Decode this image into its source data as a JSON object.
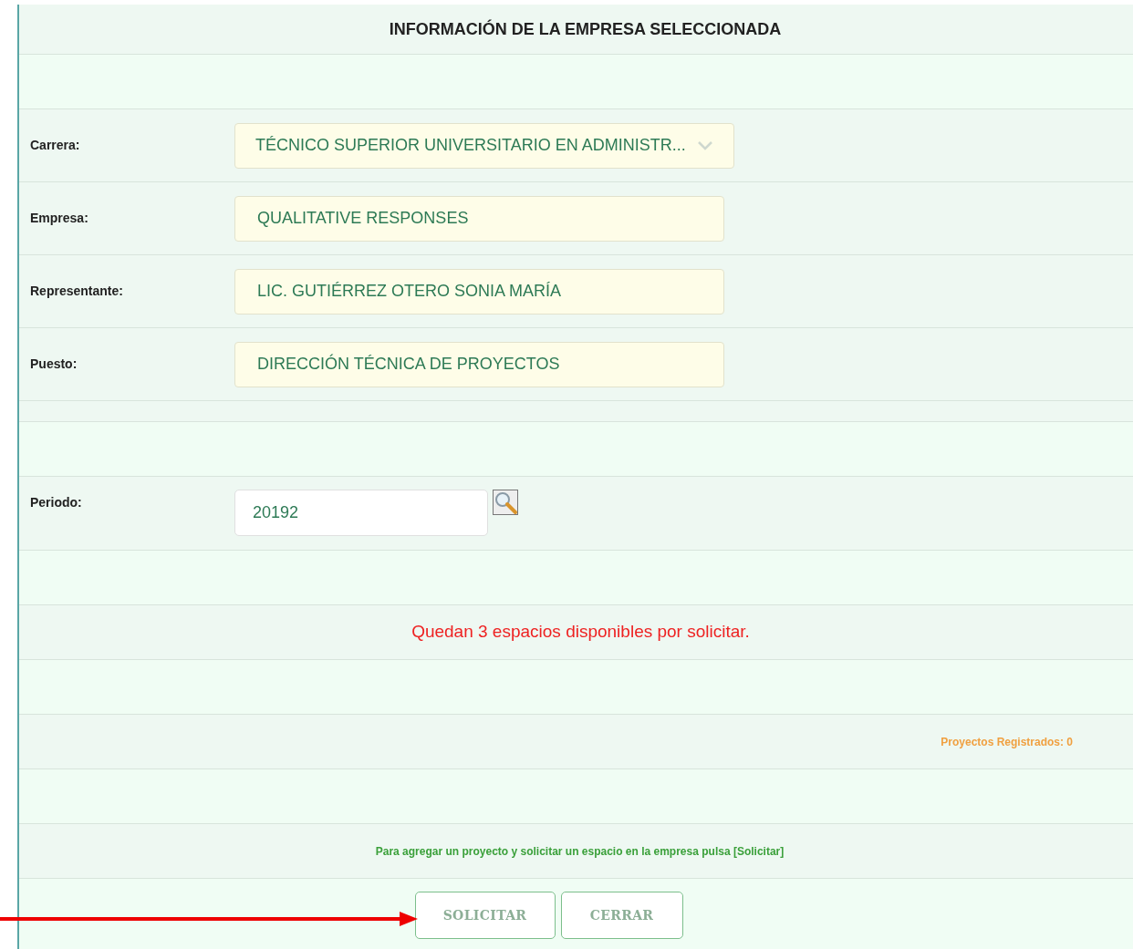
{
  "title": "INFORMACIÓN DE LA EMPRESA SELECCIONADA",
  "fields": [
    {
      "label": "Carrera:",
      "kind": "select",
      "value": "TÉCNICO SUPERIOR UNIVERSITARIO EN ADMINISTR..."
    },
    {
      "label": "Empresa:",
      "kind": "text",
      "value": "QUALITATIVE RESPONSES"
    },
    {
      "label": "Representante:",
      "kind": "text",
      "value": "LIC. GUTIÉRREZ OTERO SONIA MARÍA"
    },
    {
      "label": "Puesto:",
      "kind": "text",
      "value": "DIRECCIÓN TÉCNICA DE PROYECTOS"
    }
  ],
  "period": {
    "label": "Periodo:",
    "value": "20192"
  },
  "availability_message": "Quedan 3 espacios disponibles por solicitar.",
  "registered_projects": "Proyectos Registrados: 0",
  "instructions": "Para agregar un proyecto y solicitar un espacio en la empresa pulsa [Solicitar]",
  "buttons": [
    "SOLICITAR",
    "CERRAR"
  ]
}
